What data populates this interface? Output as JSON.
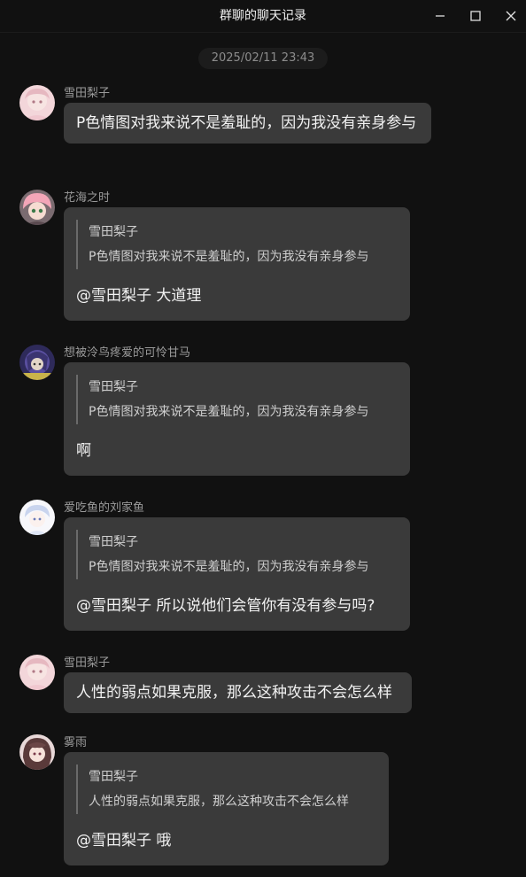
{
  "window": {
    "title": "群聊的聊天记录"
  },
  "timestamp": "2025/02/11 23:43",
  "messages": [
    {
      "sender": "雪田梨子",
      "text": "P色情图对我来说不是羞耻的，因为我没有亲身参与"
    },
    {
      "sender": "花海之时",
      "quote_name": "雪田梨子",
      "quote_text": "P色情图对我来说不是羞耻的，因为我没有亲身参与",
      "text": "@雪田梨子 大道理"
    },
    {
      "sender": "想被泠鸟疼爱的可怜甘马",
      "quote_name": "雪田梨子",
      "quote_text": "P色情图对我来说不是羞耻的，因为我没有亲身参与",
      "text": "啊"
    },
    {
      "sender": "爱吃鱼的刘家鱼",
      "quote_name": "雪田梨子",
      "quote_text": "P色情图对我来说不是羞耻的，因为我没有亲身参与",
      "text": "@雪田梨子 所以说他们会管你有没有参与吗?"
    },
    {
      "sender": "雪田梨子",
      "text": "人性的弱点如果克服，那么这种攻击不会怎么样"
    },
    {
      "sender": "雾雨",
      "quote_name": "雪田梨子",
      "quote_text": "人性的弱点如果克服，那么这种攻击不会怎么样",
      "text": "@雪田梨子 哦"
    }
  ],
  "colors": {
    "background": "#111111",
    "bubble": "#3a3a3a",
    "sender_text": "#9a9a9a",
    "quote_bar": "#6a6a6a"
  },
  "icons": [
    "minimize-icon",
    "maximize-icon",
    "close-icon",
    "avatar-image"
  ]
}
